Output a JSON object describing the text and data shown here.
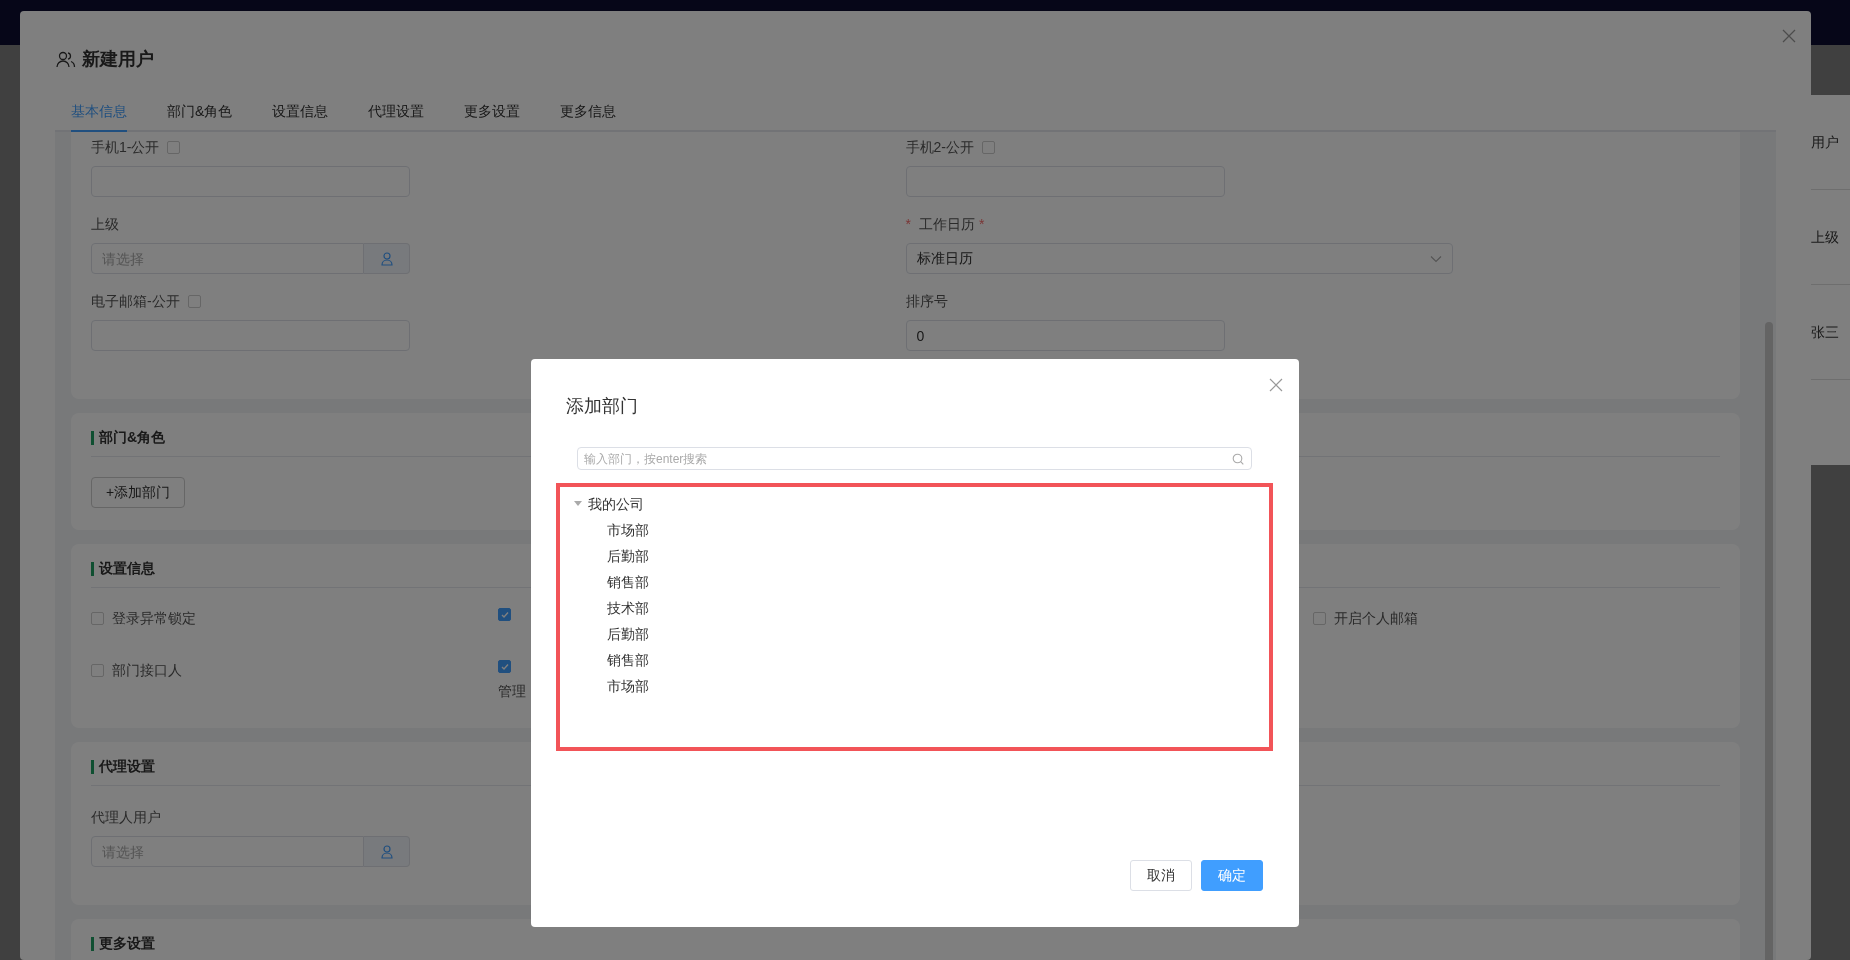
{
  "background_page": {
    "table_fragments": [
      {
        "text": "用户"
      },
      {
        "text": "上级"
      },
      {
        "text": "张三"
      }
    ]
  },
  "drawer": {
    "title": "新建用户",
    "tabs": [
      {
        "label": "基本信息",
        "selected": true
      },
      {
        "label": "部门&角色",
        "selected": false
      },
      {
        "label": "设置信息",
        "selected": false
      },
      {
        "label": "代理设置",
        "selected": false
      },
      {
        "label": "更多设置",
        "selected": false
      },
      {
        "label": "更多信息",
        "selected": false
      }
    ],
    "basic_fields": [
      {
        "kind": "input",
        "label": "手机1-公开",
        "public_checked": false
      },
      {
        "kind": "input",
        "label": "手机2-公开",
        "public_checked": false
      },
      {
        "kind": "picker",
        "label": "上级",
        "placeholder": "请选择"
      },
      {
        "kind": "select",
        "label": "工作日历",
        "prefix_mark": "*",
        "suffix_mark": "*",
        "value": "标准日历"
      },
      {
        "kind": "input",
        "label": "电子邮箱-公开",
        "public_checked": false
      },
      {
        "kind": "input",
        "label": "排序号",
        "value": "0"
      }
    ],
    "sections": [
      {
        "kind": "dept",
        "title": "部门&角色",
        "button": "+添加部门"
      },
      {
        "kind": "settings",
        "title": "设置信息",
        "rows": [
          [
            {
              "kind": "checkbox",
              "label": "登录异常锁定",
              "checked": false
            },
            {
              "kind": "checkbox",
              "checked": true
            },
            {
              "kind": "empty"
            },
            {
              "kind": "checkbox",
              "label": "开启个人邮箱",
              "checked": false
            }
          ],
          [
            {
              "kind": "checkbox",
              "label": "部门接口人",
              "checked": false
            },
            {
              "kind": "checkbox",
              "checked": true,
              "note": "管理"
            },
            {
              "kind": "empty"
            },
            {
              "kind": "empty"
            }
          ]
        ]
      },
      {
        "kind": "agent",
        "title": "代理设置",
        "label": "代理人用户",
        "placeholder": "请选择"
      },
      {
        "kind": "more",
        "title": "更多设置"
      }
    ]
  },
  "modal": {
    "title": "添加部门",
    "search_placeholder": "输入部门，按enter搜索",
    "tree_highlighted": true,
    "tree": [
      {
        "label": "我的公司",
        "expanded": true,
        "children": [
          {
            "label": "市场部"
          },
          {
            "label": "后勤部"
          },
          {
            "label": "销售部"
          },
          {
            "label": "技术部"
          },
          {
            "label": "后勤部"
          },
          {
            "label": "销售部"
          },
          {
            "label": "市场部"
          }
        ]
      }
    ],
    "buttons": [
      {
        "label": "取消",
        "kind": "default"
      },
      {
        "label": "确定",
        "kind": "primary"
      }
    ]
  }
}
